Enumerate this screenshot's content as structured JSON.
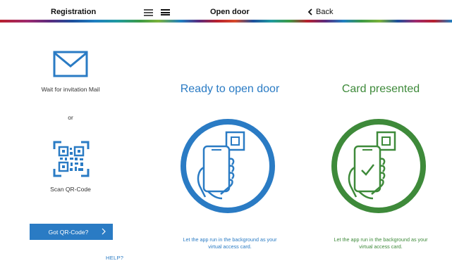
{
  "topbar": {
    "registration_title": "Registration",
    "open_door_title": "Open door",
    "back_label": "Back"
  },
  "registration": {
    "mail_caption": "Wait for invitation Mail",
    "or_text": "or",
    "scan_caption": "Scan QR-Code",
    "qr_button_label": "Got QR-Code?",
    "help_label": "HELP?"
  },
  "ready_panel": {
    "title": "Ready to open door",
    "note_line1": "Let the app run in the background as your",
    "note_line2": "virtual access card."
  },
  "card_panel": {
    "title": "Card presented",
    "note_line1": "Let the app run in the background as your",
    "note_line2": "virtual access card."
  },
  "colors": {
    "blue": "#2a7bc4",
    "green": "#3e8a3a"
  },
  "icons": [
    "hamburger-menu-icon",
    "menu-icon",
    "back-chevron-icon",
    "mail-icon",
    "qr-code-icon",
    "chevron-right-icon",
    "phone-hand-card-icon",
    "phone-hand-check-icon"
  ]
}
